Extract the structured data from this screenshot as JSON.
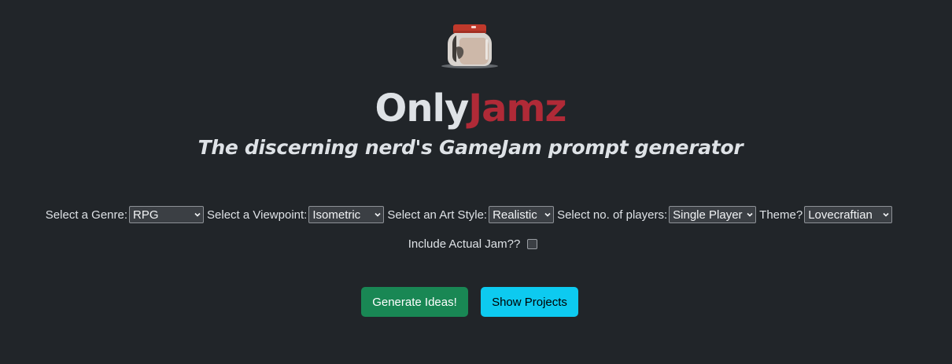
{
  "header": {
    "logo_icon": "jam-jar-icon",
    "title_part1": "Only",
    "title_part2": "Jamz",
    "title_part2_color": "#b02a37",
    "subtitle": "The discerning nerd's GameJam prompt generator"
  },
  "form": {
    "genre": {
      "label": "Select a Genre:",
      "value": "RPG"
    },
    "viewpoint": {
      "label": "Select a Viewpoint:",
      "value": "Isometric"
    },
    "art_style": {
      "label": "Select an Art Style:",
      "value": "Realistic"
    },
    "players": {
      "label": "Select no. of players:",
      "value": "Single Player"
    },
    "theme": {
      "label": "Theme?",
      "value": "Lovecraftian"
    },
    "include_jam": {
      "label": "Include Actual Jam??",
      "checked": false
    }
  },
  "actions": {
    "generate_label": "Generate Ideas!",
    "generate_color": "#198754",
    "projects_label": "Show Projects",
    "projects_color": "#0dcaf0"
  },
  "colors": {
    "background": "#212529",
    "text": "#dee2e6"
  }
}
